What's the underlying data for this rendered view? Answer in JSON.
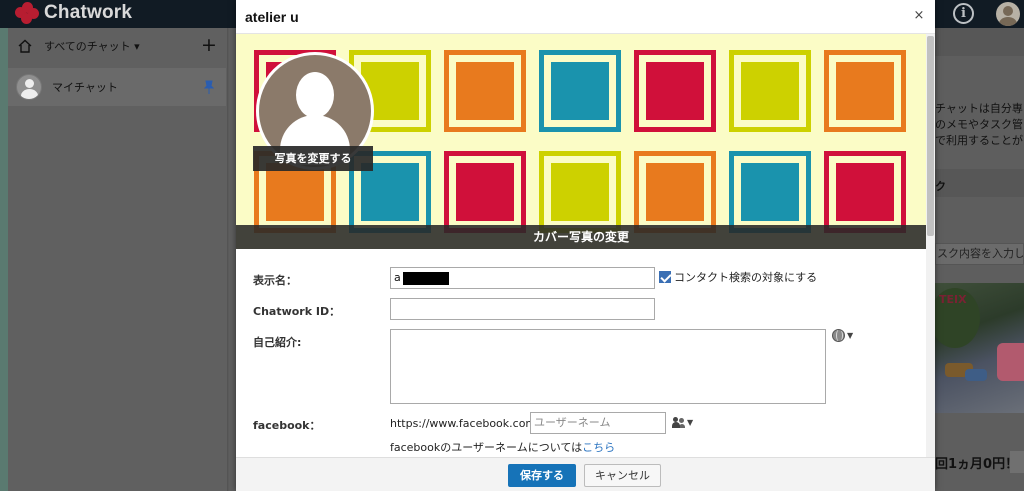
{
  "app": {
    "logo_text": "Chatwork",
    "brand_color": "#d8233a"
  },
  "sidebar": {
    "header_label": "すべてのチャット ▾",
    "chats": [
      {
        "name": "マイチャット",
        "pinned": true
      }
    ]
  },
  "right_panel": {
    "desc_lines": [
      "チャットは自分専",
      "のメモやタスク管",
      "で利用することが"
    ],
    "task_heading": "ク",
    "task_placeholder": "スク内容を入力し",
    "ad_sign": "TEIX",
    "ad_text": "回1ヵ月0円！"
  },
  "modal": {
    "title": "atelier u",
    "close_label": "×",
    "change_photo_label": "写真を変更する",
    "change_cover_label": "カバー写真の変更",
    "form": {
      "display_name_label": "表示名：",
      "display_name_value": "a",
      "contact_search_label": "コンタクト検索の対象にする",
      "contact_search_checked": true,
      "chatwork_id_label": "Chatwork ID：",
      "chatwork_id_value": "",
      "bio_label": "自己紹介:",
      "bio_value": "",
      "facebook_label": "facebook：",
      "facebook_prefix": "https://www.facebook.com/",
      "facebook_placeholder": "ユーザーネーム",
      "facebook_note": "facebookのユーザーネームについては",
      "facebook_link": "こちら"
    },
    "footer": {
      "save_label": "保存する",
      "cancel_label": "キャンセル"
    }
  },
  "colors": {
    "accent": "#1673b8",
    "cover_bg": "#fbfcc6",
    "pattern": [
      "#d0103a",
      "#cdd100",
      "#e87a1e",
      "#1a93ad"
    ]
  }
}
